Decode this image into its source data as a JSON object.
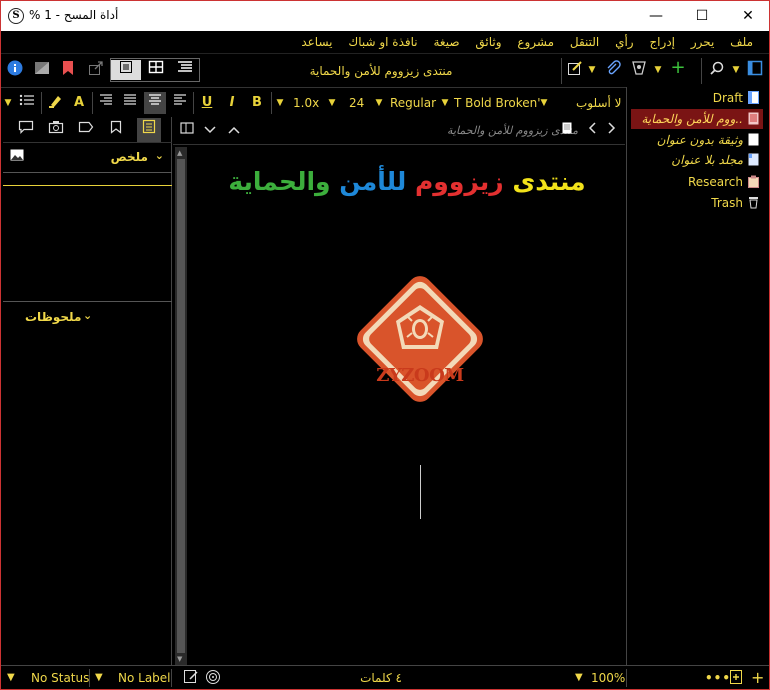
{
  "window": {
    "title": "أداة المسح - 1 %",
    "minimize": "—",
    "maximize": "☐",
    "close": "✕"
  },
  "menu": [
    "ملف",
    "يحرر",
    "إدراج",
    "رأي",
    "التنقل",
    "مشروع",
    "وثائق",
    "صيغة",
    "نافذة او شباك",
    "يساعد"
  ],
  "toolbar": {
    "document_title": "منتدى زيزووم للأمن والحماية"
  },
  "format": {
    "style": "لا أسلوب",
    "font": "T Bold Broken'",
    "weight": "Regular",
    "size": "24",
    "line_spacing": "1.0x",
    "bold": "B",
    "italic": "I",
    "underline": "U",
    "text_color": "A"
  },
  "inspector": {
    "synopsis_label": "ملخص",
    "notes_label": "ملحوظات"
  },
  "editor": {
    "breadcrumb": "منتدى زيزووم للأمن والحماية",
    "headline_parts": [
      {
        "text": "منتدى ",
        "color": "#f2e21a"
      },
      {
        "text": "زيزووم ",
        "color": "#e33030"
      },
      {
        "text": "للأمن ",
        "color": "#1e88d8"
      },
      {
        "text": "والحماية",
        "color": "#3cae3c"
      }
    ],
    "logo_text": "ZYZOOM"
  },
  "binder": {
    "items": [
      {
        "label": "Draft",
        "icon": "folder-doc-icon",
        "level": 0
      },
      {
        "label": "..ووم للأمن والحماية",
        "icon": "doc-red-icon",
        "level": 1,
        "selected": true
      },
      {
        "label": "وثيقة بدون عنوان",
        "icon": "doc-white-icon",
        "level": 1
      },
      {
        "label": "مجلد بلا عنوان",
        "icon": "folder-icon",
        "level": 1
      },
      {
        "label": "Research",
        "icon": "research-icon",
        "level": 0
      },
      {
        "label": "Trash",
        "icon": "trash-icon",
        "level": 0
      }
    ]
  },
  "status": {
    "word_count": "٤ كلمات",
    "zoom": "100%",
    "status": "No Status",
    "label": "No Label"
  },
  "colors": {
    "accent": "#f0d84a",
    "selected_bg": "#7a1414",
    "logo_orange": "#d9542b",
    "logo_cream": "#f3d9b8"
  }
}
